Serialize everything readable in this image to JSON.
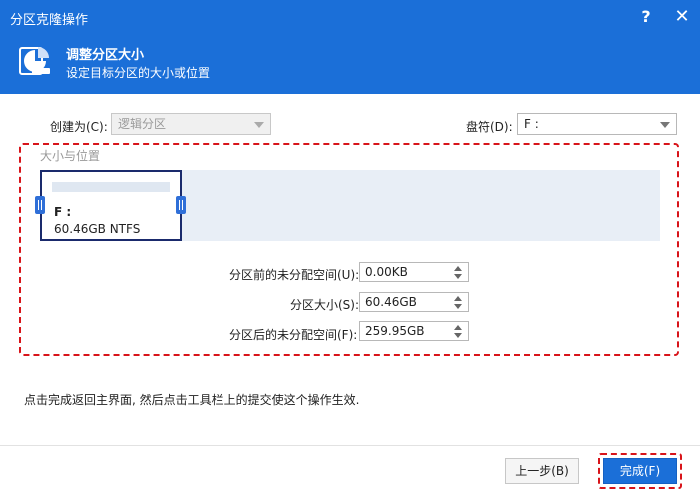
{
  "window": {
    "title": "分区克隆操作",
    "help_label": "?",
    "close_label": "✕"
  },
  "header": {
    "icon": "partition-pie-icon",
    "title": "调整分区大小",
    "subtitle": "设定目标分区的大小或位置"
  },
  "create_as": {
    "label": "创建为(C):",
    "value": "逻辑分区"
  },
  "drive_letter": {
    "label": "盘符(D):",
    "value": "F :"
  },
  "size_position": {
    "group_title": "大小与位置",
    "partition": {
      "name": "F :",
      "info": "60.46GB NTFS"
    },
    "fields": [
      {
        "label": "分区前的未分配空间(U):",
        "value": "0.00KB"
      },
      {
        "label": "分区大小(S):",
        "value": "60.46GB"
      },
      {
        "label": "分区后的未分配空间(F):",
        "value": "259.95GB"
      }
    ]
  },
  "note": "点击完成返回主界面, 然后点击工具栏上的提交使这个操作生效.",
  "buttons": {
    "back": "上一步(B)",
    "finish": "完成(F)"
  },
  "colors": {
    "accent": "#1b6fd8",
    "highlight": "#d8141a"
  }
}
